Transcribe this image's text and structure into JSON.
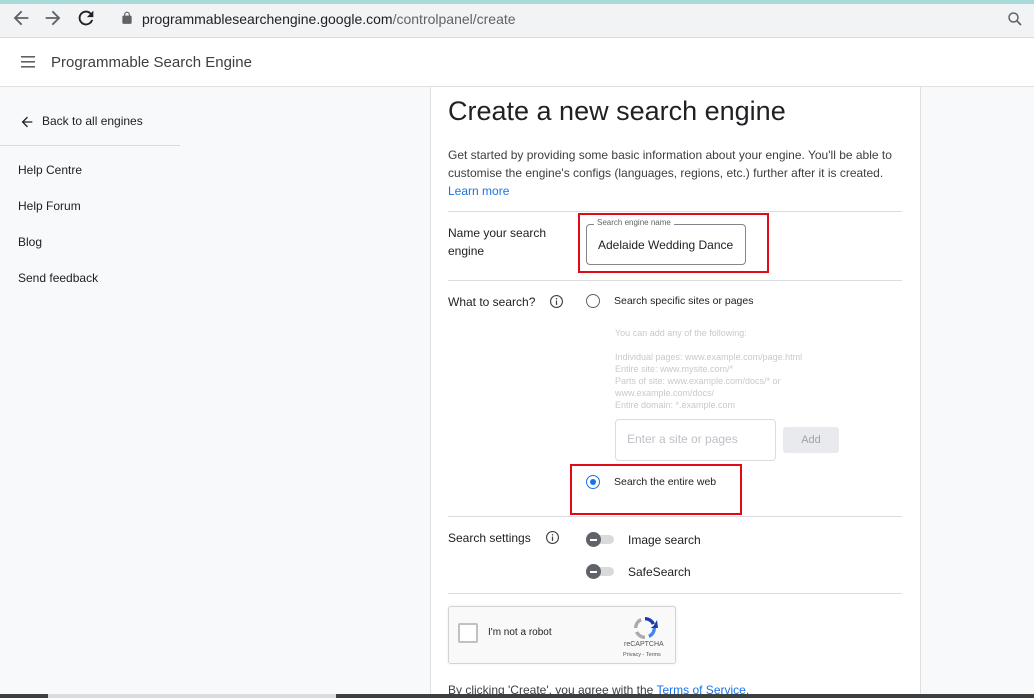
{
  "browser": {
    "url_host": "programmablesearchengine.google.com",
    "url_path": "/controlpanel/create"
  },
  "app": {
    "title": "Programmable Search Engine"
  },
  "sidebar": {
    "back_label": "Back to all engines",
    "links": [
      "Help Centre",
      "Help Forum",
      "Blog",
      "Send feedback"
    ]
  },
  "page": {
    "title": "Create a new search engine",
    "intro": "Get started by providing some basic information about your engine. You'll be able to customise the engine's configs (languages, regions, etc.) further after it is created.",
    "learn_more": "Learn more"
  },
  "name_section": {
    "label": "Name your search engine",
    "field_label": "Search engine name",
    "value": "Adelaide Wedding Dance"
  },
  "what_section": {
    "label": "What to search?",
    "option_specific": "Search specific sites or pages",
    "hint_intro": "You can add any of the following:",
    "hints": [
      "Individual pages: www.example.com/page.html",
      "Entire site: www.mysite.com/*",
      "Parts of site: www.example.com/docs/* or",
      "www.example.com/docs/",
      "Entire domain: *.example.com"
    ],
    "site_placeholder": "Enter a site or pages",
    "add_label": "Add",
    "option_entire": "Search the entire web",
    "selected": "entire"
  },
  "settings_section": {
    "label": "Search settings",
    "image_search": "Image search",
    "safesearch": "SafeSearch"
  },
  "recaptcha": {
    "label": "I'm not a robot",
    "brand": "reCAPTCHA",
    "terms": "Privacy - Terms"
  },
  "footer": {
    "tos_prefix": "By clicking 'Create', you agree with the ",
    "tos_link": "Terms of Service."
  },
  "colors": {
    "accent": "#1a73e8",
    "highlight": "#e00b16"
  }
}
